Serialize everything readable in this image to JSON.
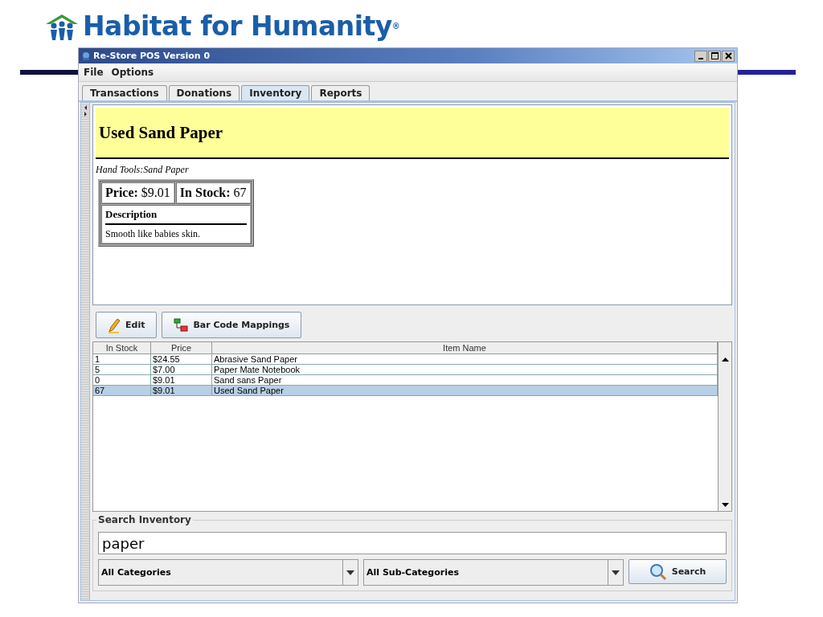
{
  "logo": {
    "text": "Habitat for Humanity",
    "mark": "®"
  },
  "window": {
    "title": "Re-Store POS Version 0"
  },
  "menu": [
    "File",
    "Options"
  ],
  "tabs": [
    {
      "label": "Transactions",
      "selected": false
    },
    {
      "label": "Donations",
      "selected": false
    },
    {
      "label": "Inventory",
      "selected": true
    },
    {
      "label": "Reports",
      "selected": false
    }
  ],
  "item": {
    "name": "Used Sand Paper",
    "category": "Hand Tools:Sand Paper",
    "price_label": "Price:",
    "price": "$9.01",
    "stock_label": "In Stock:",
    "stock": "67",
    "description_label": "Description",
    "description": "Smooth like babies skin."
  },
  "buttons": [
    {
      "label": "Edit",
      "kind": "edit"
    },
    {
      "label": "Bar Code Mappings",
      "kind": "mappings"
    }
  ],
  "table": {
    "columns": [
      "In Stock",
      "Price",
      "Item Name"
    ],
    "rows": [
      {
        "cells": [
          "1",
          "$24.55",
          "Abrasive Sand Paper"
        ],
        "selected": false
      },
      {
        "cells": [
          "5",
          "$7.00",
          "Paper Mate Notebook"
        ],
        "selected": false
      },
      {
        "cells": [
          "0",
          "$9.01",
          "Sand sans Paper"
        ],
        "selected": false
      },
      {
        "cells": [
          "67",
          "$9.01",
          "Used Sand Paper"
        ],
        "selected": true
      }
    ]
  },
  "search": {
    "title": "Search Inventory",
    "value": "paper",
    "category": "All Categories",
    "subcategory": "All Sub-Categories",
    "button": "Search"
  }
}
